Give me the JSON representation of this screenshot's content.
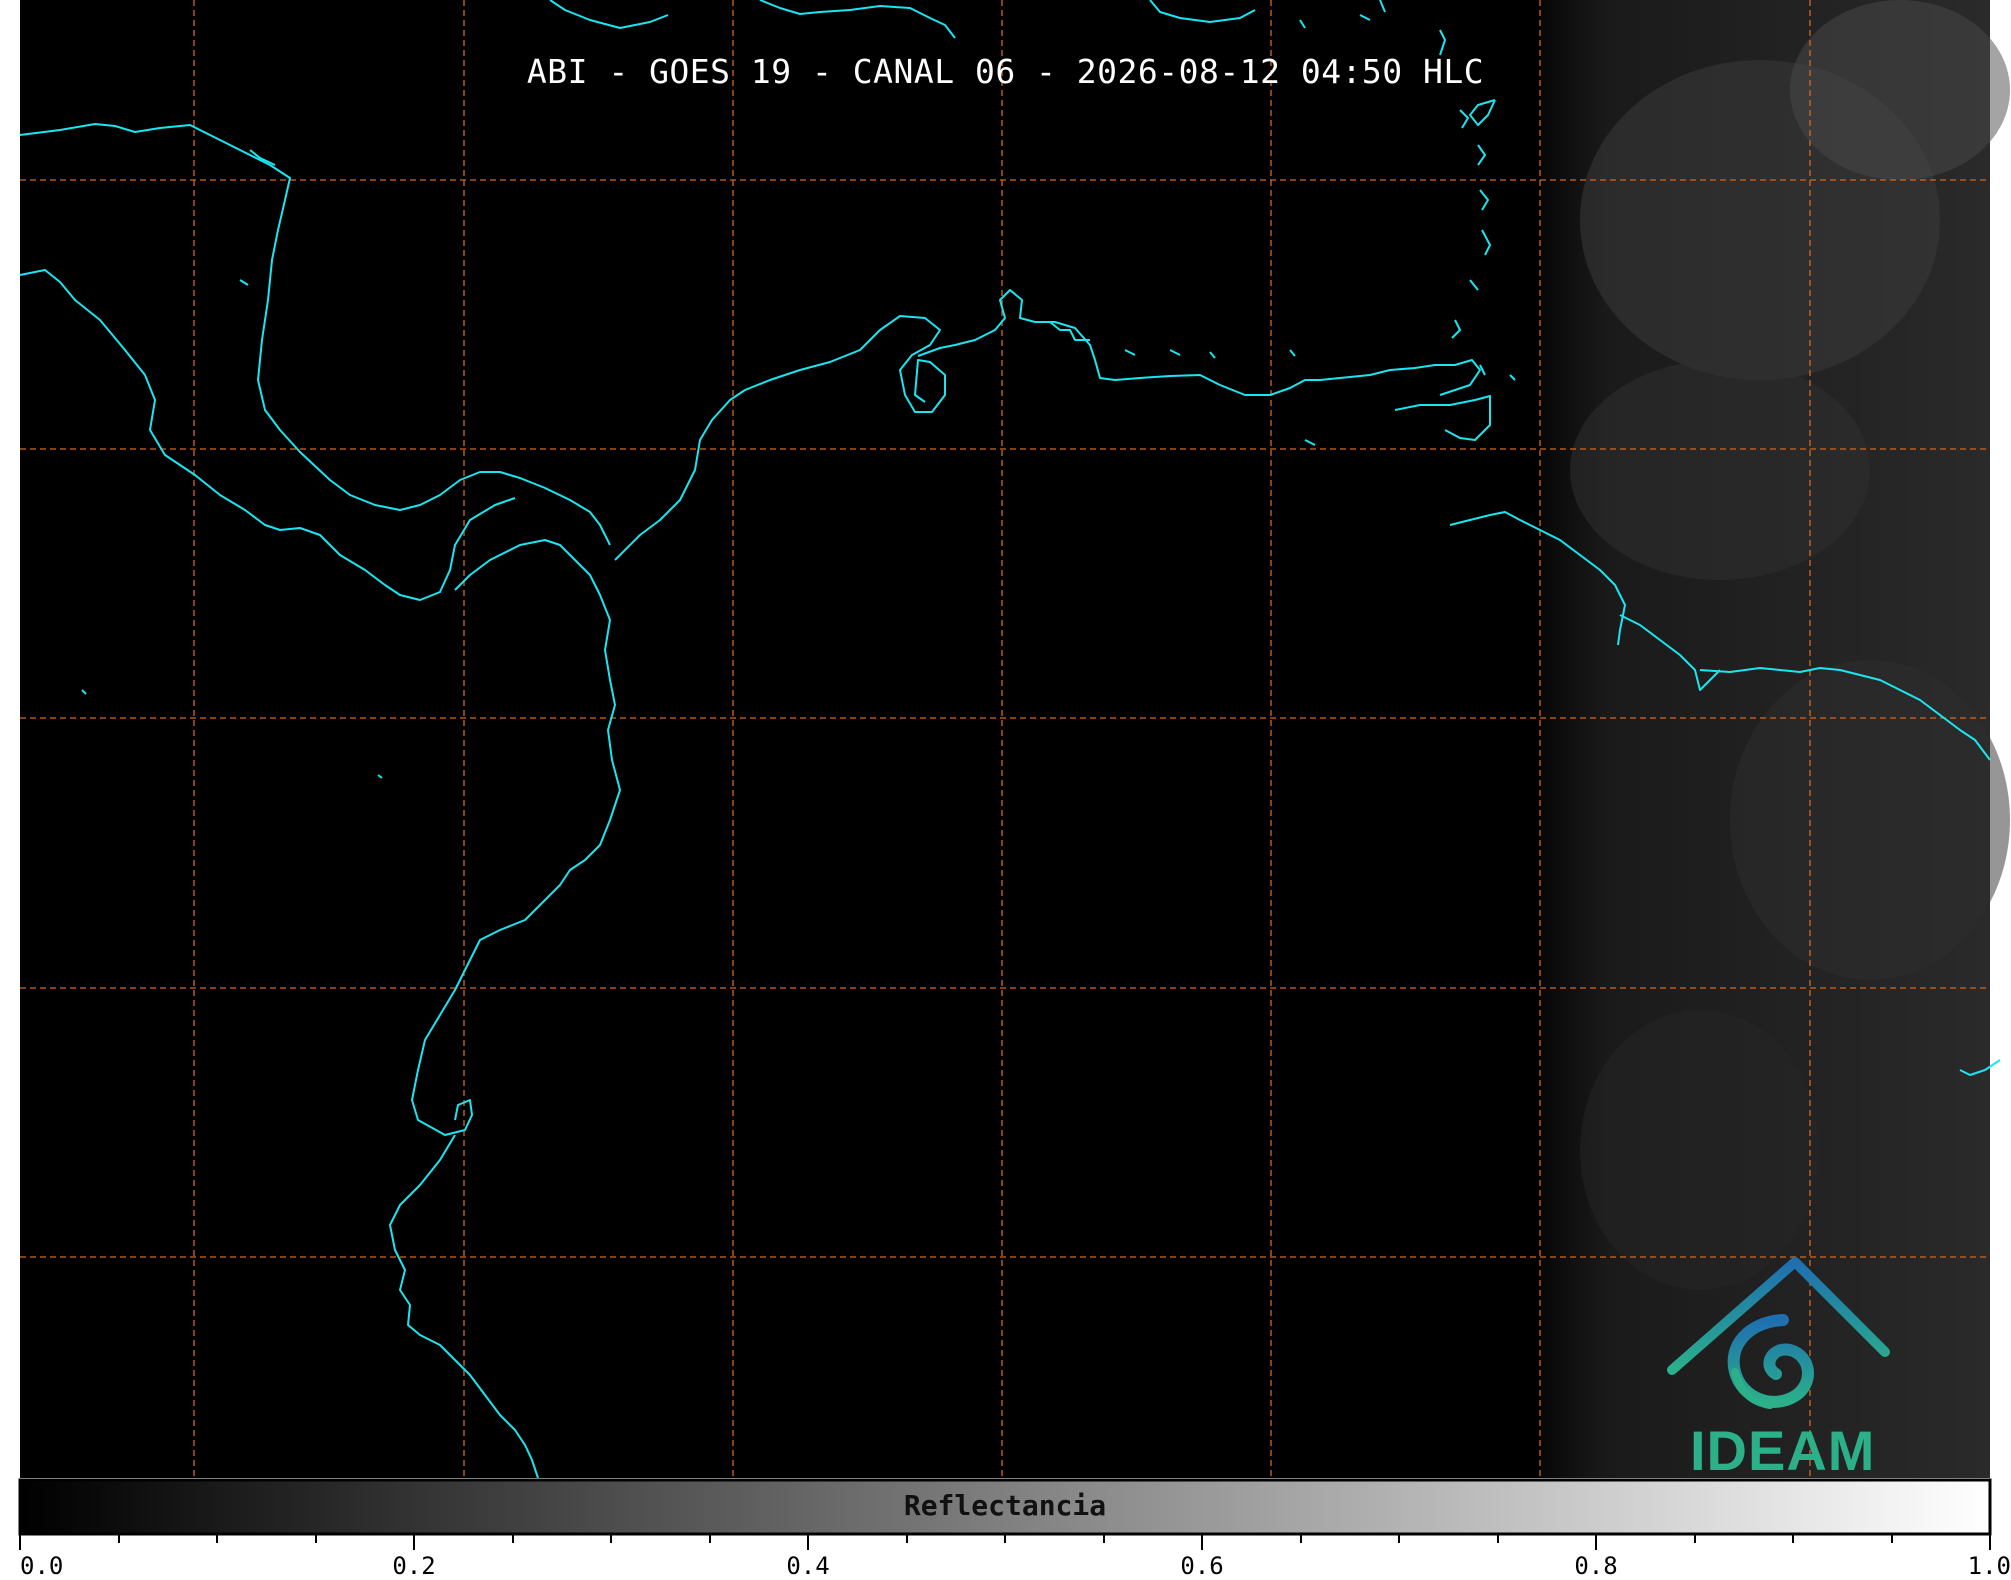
{
  "title": "ABI - GOES 19 - CANAL 06 - 2026-08-12 04:50 HLC",
  "colorbar": {
    "label": "Reflectancia",
    "ticks": [
      "0.0",
      "0.2",
      "0.4",
      "0.6",
      "0.8",
      "1.0"
    ],
    "range": [
      0.0,
      1.0
    ]
  },
  "logo": {
    "text": "IDEAM"
  },
  "colors": {
    "background": "#000000",
    "coastline": "#19e6f0",
    "gridline": "#d2691e",
    "logo_blue": "#1e6fb0",
    "logo_teal": "#2bb08a"
  },
  "gridlines": {
    "style": "dashed",
    "visible": true
  },
  "icons": [
    "ideam-logo-icon"
  ]
}
